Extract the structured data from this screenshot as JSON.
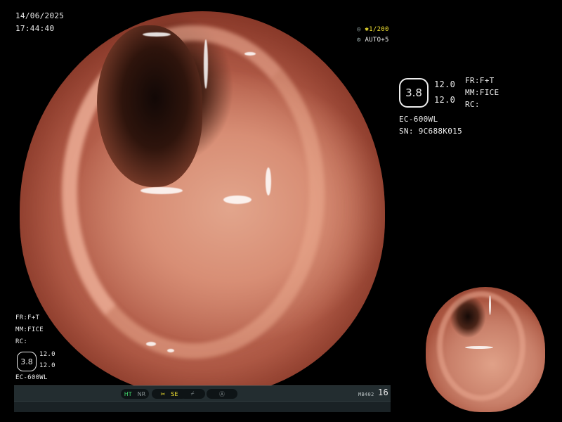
{
  "overlay": {
    "date": "14/06/2025",
    "time": "17:44:40",
    "shutter": "1/200",
    "auto_exposure": "AUTO+5"
  },
  "right_panel": {
    "badge_value": "3.8",
    "zoom_1": "12.0",
    "zoom_2": "12.0",
    "fr": "FR:F+T",
    "mm": "MM:FICE",
    "rc": "RC:",
    "scope_model": "EC-600WL",
    "serial": "SN: 9C688K015"
  },
  "left_panel": {
    "fr": "FR:F+T",
    "mm": "MM:FICE",
    "rc": "RC:",
    "badge_value": "3.8",
    "zoom_1": "12.0",
    "zoom_2": "12.0",
    "scope_model": "EC-600WL"
  },
  "status_bar": {
    "ht": "HT",
    "nr": "NR",
    "se": "SE",
    "code": "MB402",
    "number": "16"
  },
  "colors": {
    "indicator_green": "#3fd36a",
    "indicator_yellow": "#f0e030",
    "bar_background": "#232d30"
  },
  "icons": [
    "focus-icon",
    "star-icon",
    "auto-icon",
    "scissors-icon",
    "slash-icon",
    "circle-a-icon"
  ]
}
